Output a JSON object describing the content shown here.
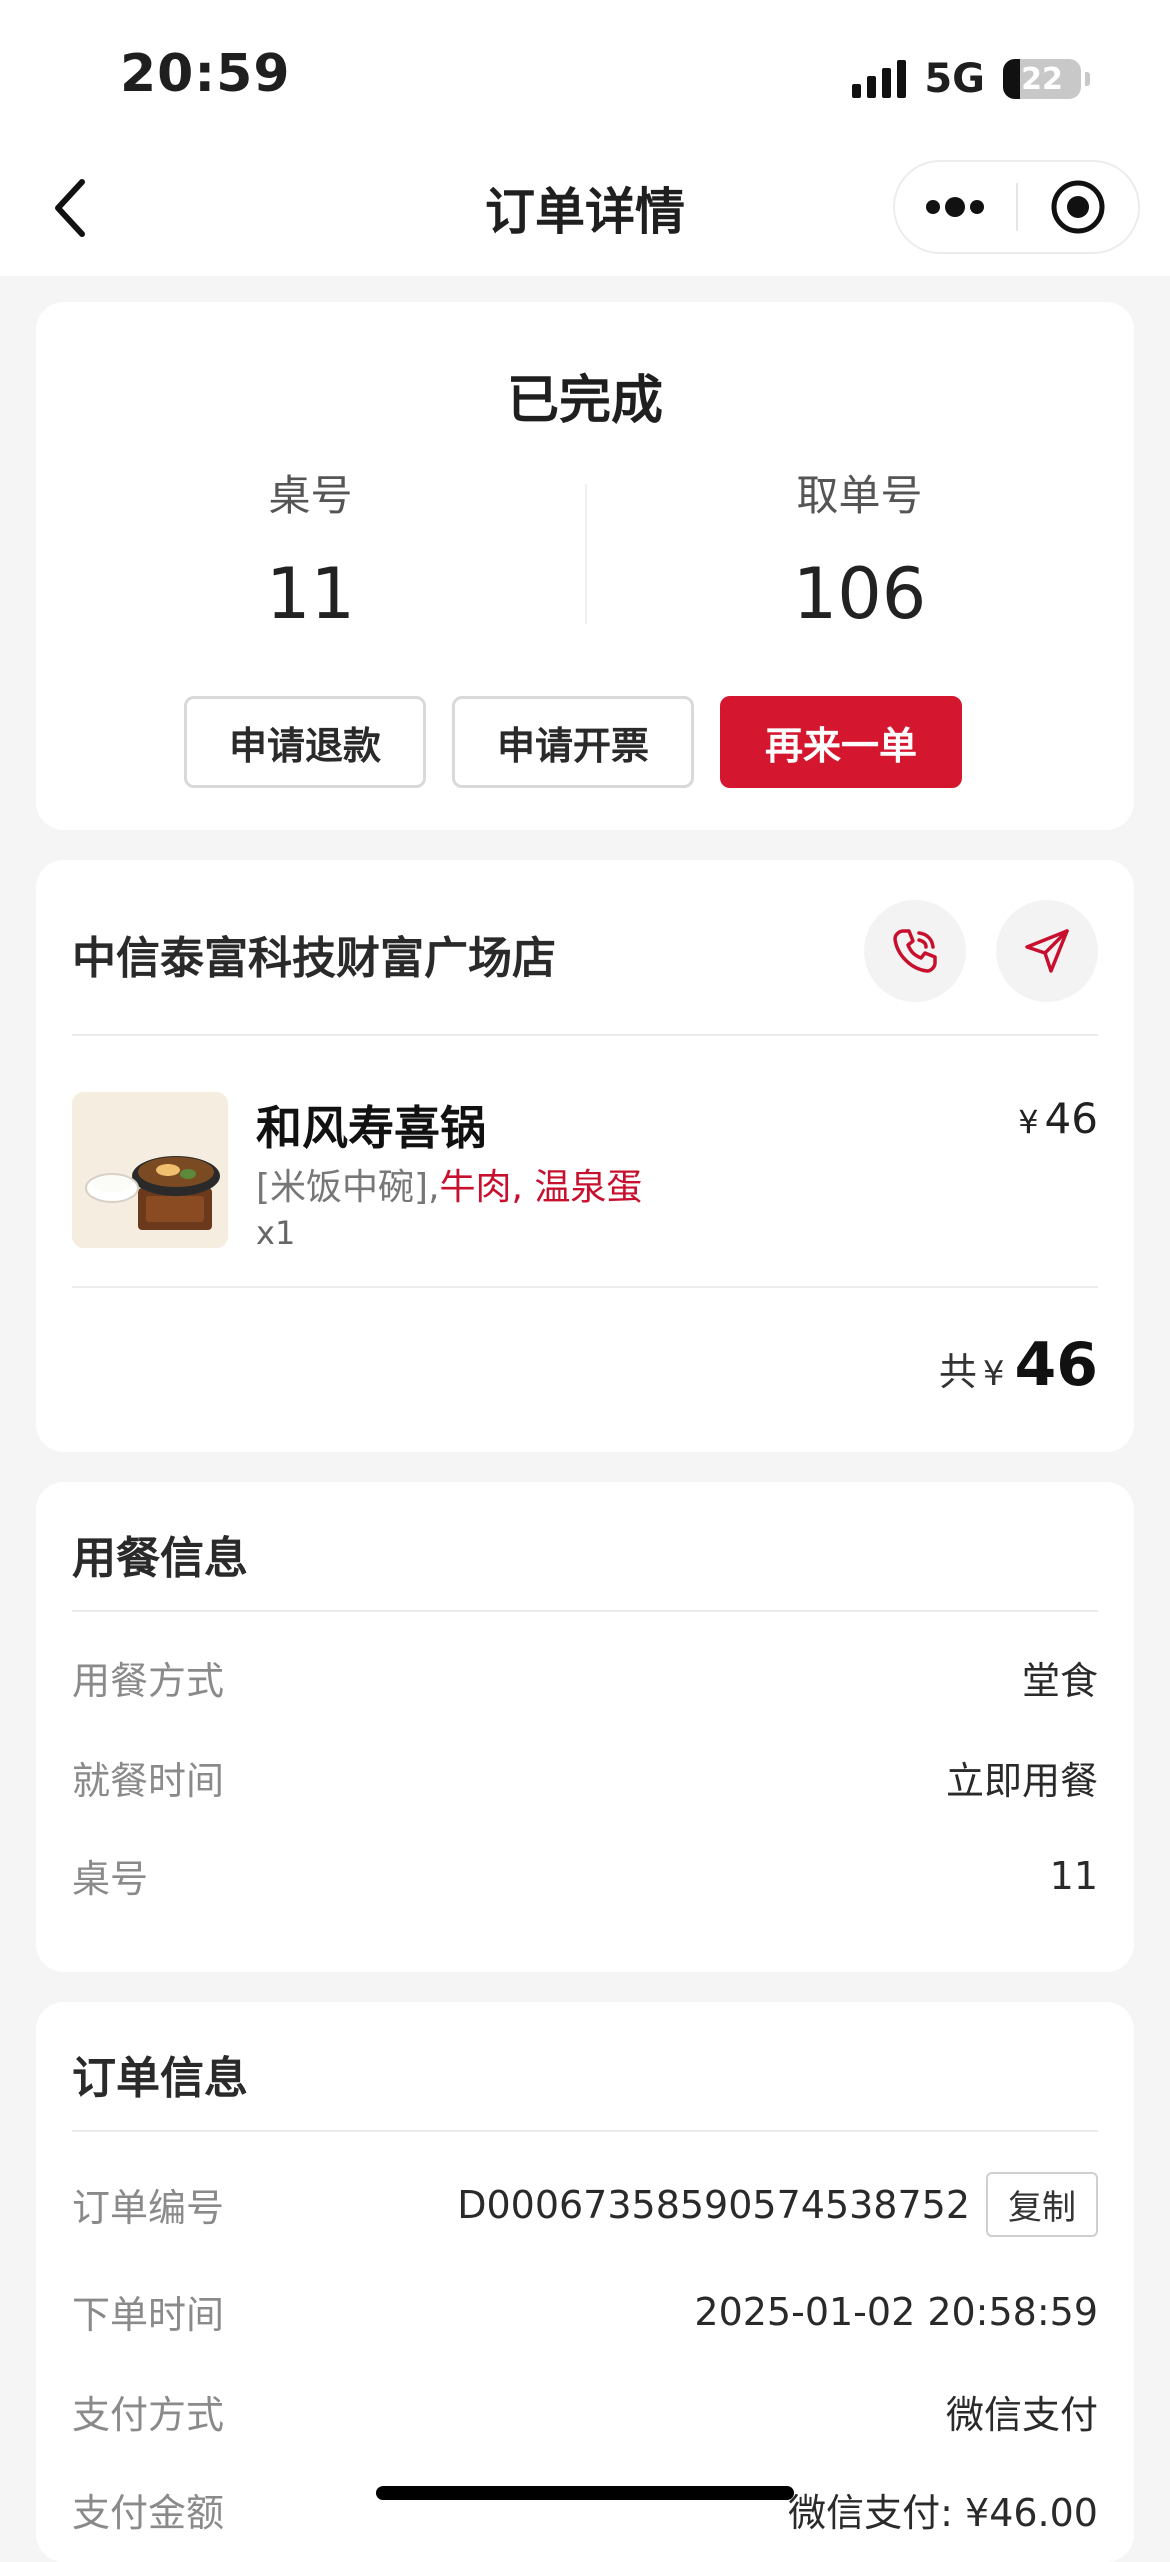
{
  "status_bar": {
    "time": "20:59",
    "network": "5G",
    "battery": "22",
    "battery_level": 0.22
  },
  "nav": {
    "title": "订单详情"
  },
  "order_status": {
    "title": "已完成",
    "table_label": "桌号",
    "table_value": "11",
    "pickup_label": "取单号",
    "pickup_value": "106",
    "buttons": {
      "refund": "申请退款",
      "invoice": "申请开票",
      "reorder": "再来一单"
    }
  },
  "store": {
    "name": "中信泰富科技财富广场店",
    "item": {
      "name": "和风寿喜锅",
      "options_prefix": "[米饭中碗],",
      "options_highlight": "牛肉, 温泉蛋",
      "qty": "x1",
      "currency": "¥",
      "price": "46"
    },
    "total_label": "共",
    "total_currency": "¥",
    "total_amount": "46"
  },
  "dining_info": {
    "title": "用餐信息",
    "rows": [
      {
        "label": "用餐方式",
        "value": "堂食"
      },
      {
        "label": "就餐时间",
        "value": "立即用餐"
      },
      {
        "label": "桌号",
        "value": "11"
      }
    ]
  },
  "order_info": {
    "title": "订单信息",
    "copy_label": "复制",
    "rows": [
      {
        "label": "订单编号",
        "value": "D00067358590574538752"
      },
      {
        "label": "下单时间",
        "value": "2025-01-02 20:58:59"
      },
      {
        "label": "支付方式",
        "value": "微信支付"
      },
      {
        "label": "支付金额",
        "value": "微信支付: ¥46.00"
      }
    ]
  },
  "colors": {
    "accent": "#d4172f",
    "background": "#f5f5f5",
    "card": "#ffffff"
  }
}
